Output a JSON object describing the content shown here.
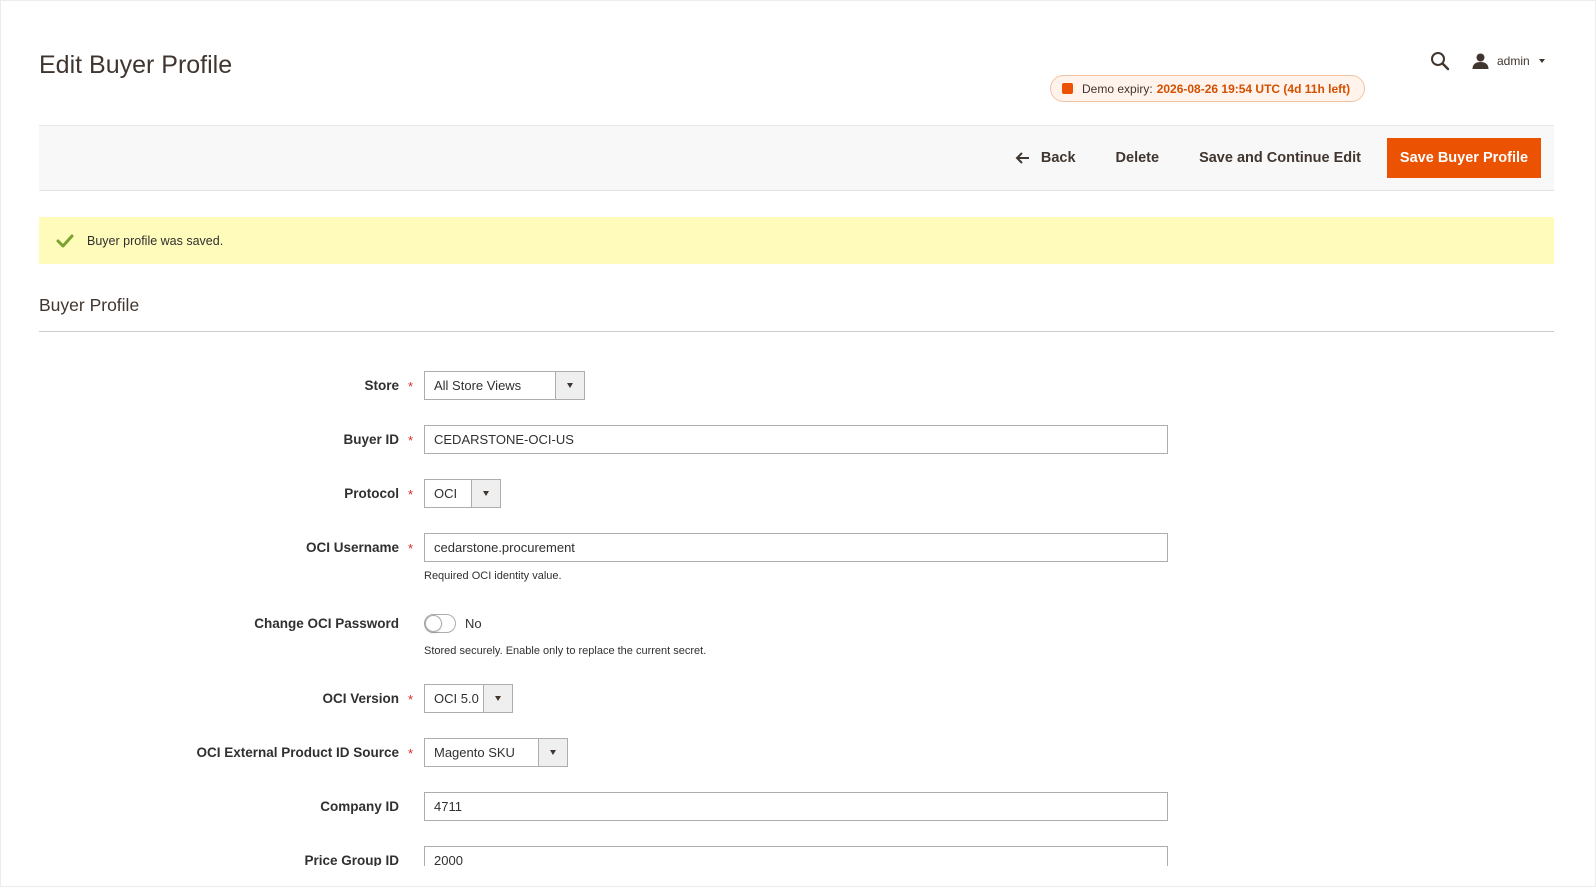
{
  "header": {
    "title": "Edit Buyer Profile",
    "user_name": "admin",
    "icons": {
      "search": "search-icon",
      "user": "user-icon",
      "menu": "chevron-down-icon"
    }
  },
  "demo_badge": {
    "label": "Demo expiry:",
    "value": "2026-08-26 19:54 UTC (4d 11h left)",
    "icon": "status-square-icon"
  },
  "actions": {
    "back_icon": "arrow-left-icon",
    "back": "Back",
    "delete": "Delete",
    "save_continue": "Save and Continue Edit",
    "save": "Save Buyer Profile"
  },
  "message": {
    "icon": "check-icon",
    "text": "Buyer profile was saved."
  },
  "section": {
    "title": "Buyer Profile"
  },
  "form": {
    "required_marker": "*",
    "fields": [
      {
        "label": "Store",
        "type": "select",
        "value": "All Store Views",
        "required": true
      },
      {
        "label": "Buyer ID",
        "type": "text",
        "value": "CEDARSTONE-OCI-US",
        "required": true
      },
      {
        "label": "Protocol",
        "type": "select",
        "value": "OCI",
        "required": true
      },
      {
        "label": "OCI Username",
        "type": "text",
        "value": "cedarstone.procurement",
        "required": true,
        "note": "Required OCI identity value."
      },
      {
        "label": "Change OCI Password",
        "type": "toggle",
        "value": "No",
        "required": false,
        "note": "Stored securely. Enable only to replace the current secret."
      },
      {
        "label": "OCI Version",
        "type": "select",
        "value": "OCI 5.0",
        "required": true
      },
      {
        "label": "OCI External Product ID Source",
        "type": "select",
        "value": "Magento SKU",
        "required": true
      },
      {
        "label": "Company ID",
        "type": "text",
        "value": "4711",
        "required": false
      },
      {
        "label": "Price Group ID",
        "type": "text",
        "value": "2000",
        "required": false
      }
    ]
  },
  "colors": {
    "accent": "#eb5202",
    "success": "#79a22e",
    "message_background": "#fffbbb",
    "required": "#e22626",
    "text": "#41362f"
  }
}
